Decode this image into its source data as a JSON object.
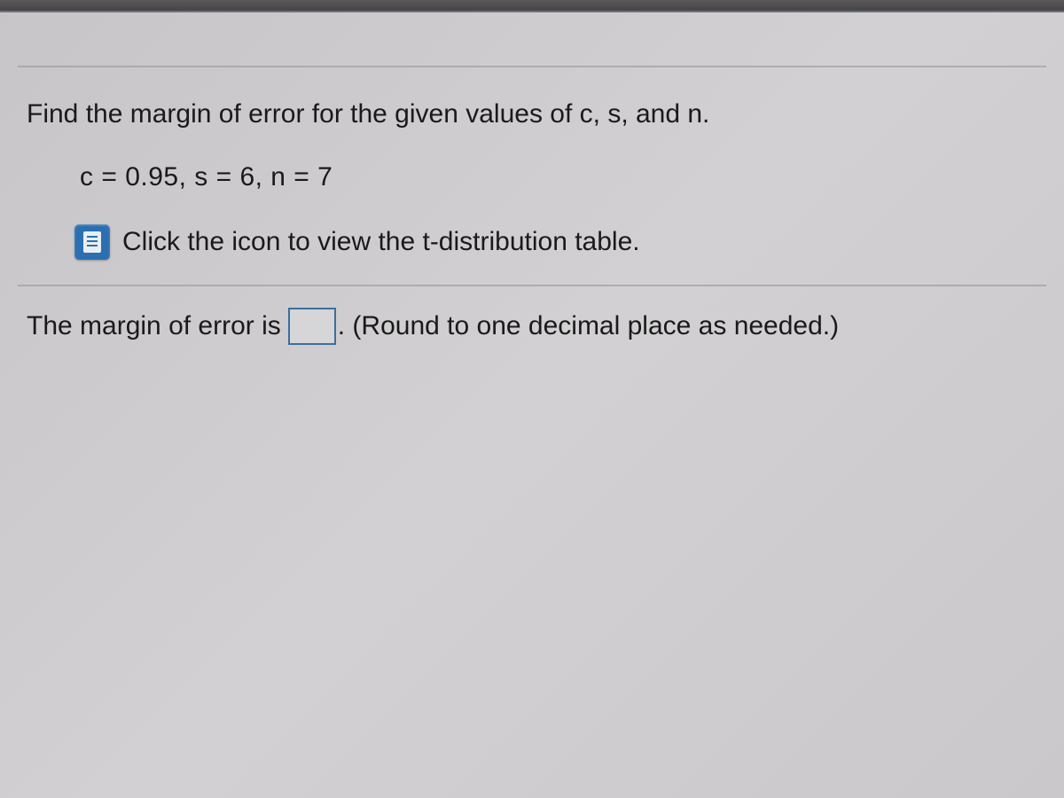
{
  "question": {
    "prompt": "Find the margin of error for the given values of c, s, and n.",
    "values_line": "c = 0.95, s = 6, n = 7",
    "link_text": "Click the icon to view the t-distribution table."
  },
  "answer": {
    "prefix": "The margin of error is ",
    "input_value": "",
    "suffix": ". (Round to one decimal place as needed.)"
  },
  "icons": {
    "table": "table-icon"
  }
}
